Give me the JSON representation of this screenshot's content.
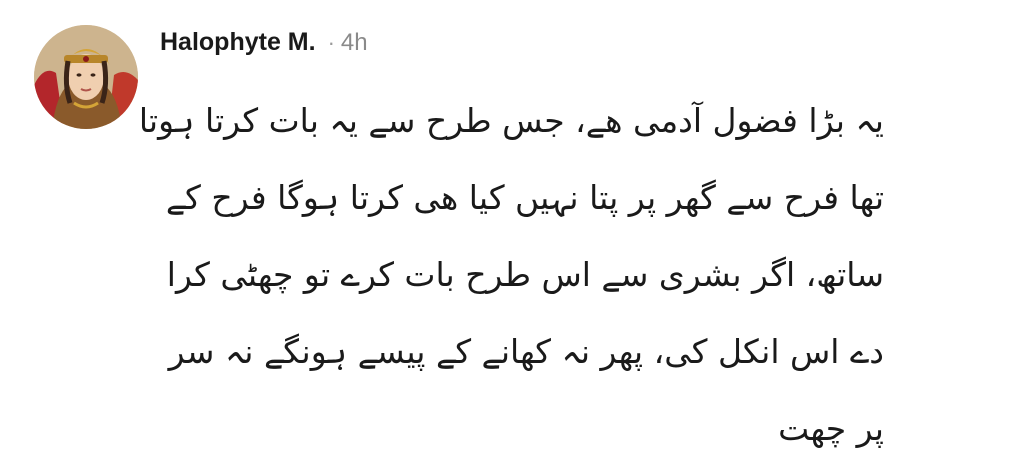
{
  "post": {
    "author": "Halophyte M.",
    "separator": "·",
    "time": "4h",
    "avatar_icon": "profile-photo",
    "lines": [
      "یہ بڑا فضول آدمی ھے، جس طرح سے یہ بات کرتا ہوتا",
      "تھا فرح سے گھر پر پتا نہیں کیا ھی کرتا ہوگا فرح کے",
      "ساتھ، اگر بشری سے اس طرح بات کرے تو چھٹی کرا",
      "دے اس انکل کی، پھر نہ کھانے کے پیسے ہونگے نہ سر",
      "پر چھت"
    ]
  },
  "colors": {
    "author": "#1a1a1a",
    "meta": "#8a8a8a",
    "body": "#1a1a1a"
  }
}
